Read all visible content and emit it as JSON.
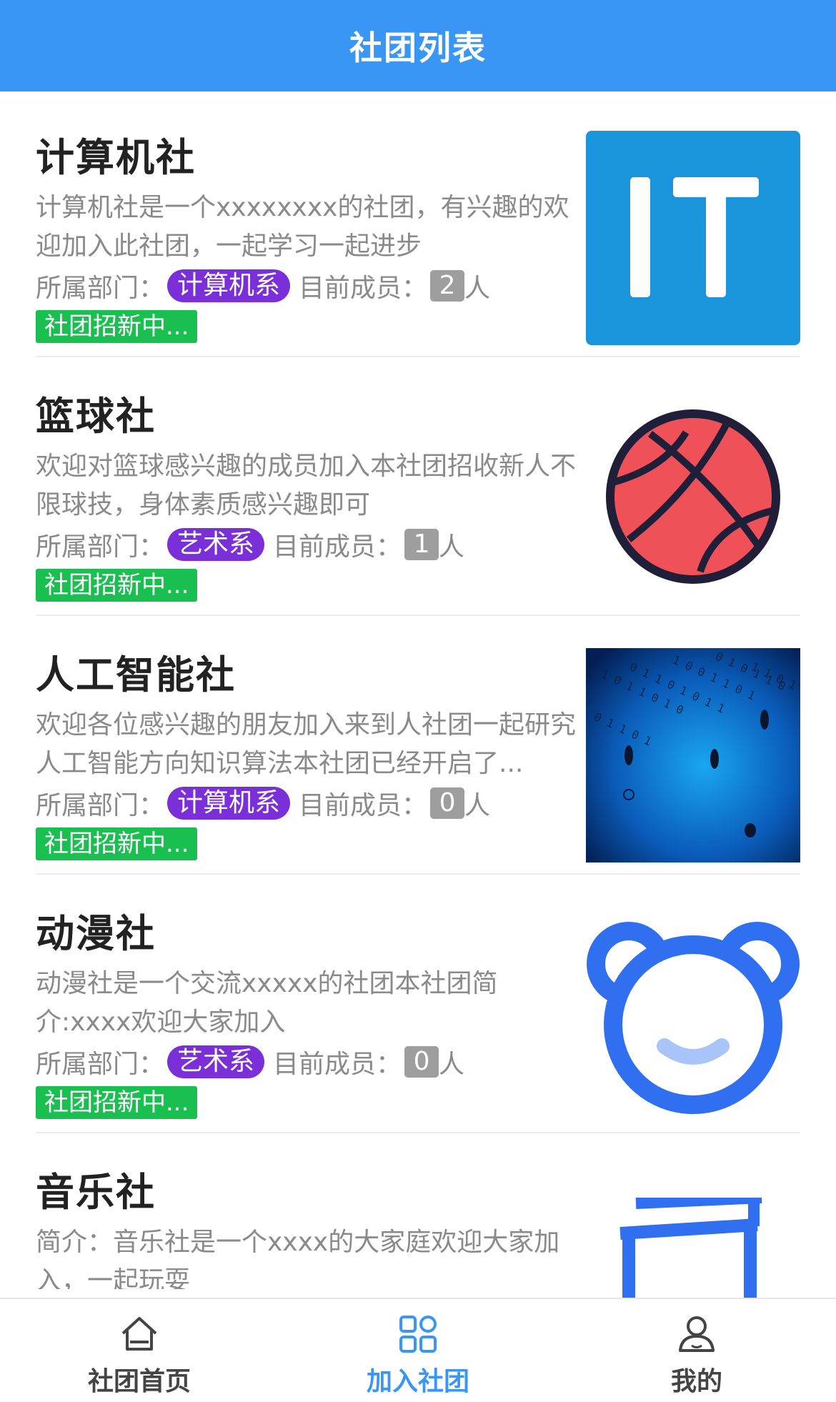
{
  "header": {
    "title": "社团列表"
  },
  "meta_labels": {
    "dept": "所属部门：",
    "members": "目前成员：",
    "person_unit": "人"
  },
  "clubs": [
    {
      "name": "计算机社",
      "description": "计算机社是一个xxxxxxxx的社团，有兴趣的欢迎加入此社团，一起学习一起进步",
      "department": "计算机系",
      "member_count": "2",
      "status": "社团招新中...",
      "image_icon": "it-logo-icon",
      "image_text": "IT"
    },
    {
      "name": "篮球社",
      "description": "欢迎对篮球感兴趣的成员加入本社团招收新人不限球技，身体素质感兴趣即可",
      "department": "艺术系",
      "member_count": "1",
      "status": "社团招新中...",
      "image_icon": "basketball-icon"
    },
    {
      "name": "人工智能社",
      "description": "欢迎各位感兴趣的朋友加入来到人社团一起研究人工智能方向知识算法本社团已经开启了...",
      "department": "计算机系",
      "member_count": "0",
      "status": "社团招新中...",
      "image_icon": "binary-data-photo-icon"
    },
    {
      "name": "动漫社",
      "description": "动漫社是一个交流xxxxx的社团本社团简介:xxxx欢迎大家加入",
      "department": "艺术系",
      "member_count": "0",
      "status": "社团招新中...",
      "image_icon": "bear-face-icon"
    },
    {
      "name": "音乐社",
      "description": "简介：音乐社是一个xxxx的大家庭欢迎大家加入，一起玩耍",
      "image_icon": "music-gate-icon"
    }
  ],
  "tabs": [
    {
      "label": "社团首页",
      "icon": "home-icon",
      "active": false
    },
    {
      "label": "加入社团",
      "icon": "grid-icon",
      "active": true
    },
    {
      "label": "我的",
      "icon": "user-icon",
      "active": false
    }
  ],
  "colors": {
    "header_bg": "#3a96f4",
    "dept_tag": "#7b2fd8",
    "count_tag": "#9e9e9e",
    "recruit_badge": "#19c050",
    "tab_active": "#3a96f4"
  }
}
